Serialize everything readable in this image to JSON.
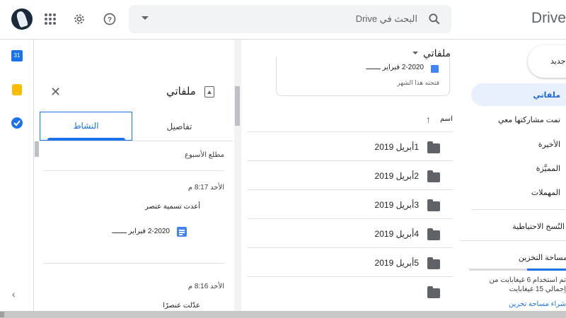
{
  "topbar": {
    "search_placeholder": "البحث في Drive",
    "brand": "Drive"
  },
  "icons": {
    "apps": "apps-grid-icon",
    "settings": "gear-icon",
    "help": "help-icon",
    "search": "search-icon"
  },
  "left_rail": {
    "calendar_label": "31"
  },
  "toolbar": {
    "location_label": "ملفاتي"
  },
  "details_panel": {
    "title": "ملفاتي",
    "tabs": [
      {
        "label": "تفاصيل",
        "active": false
      },
      {
        "label": "النشاط",
        "active": true
      }
    ],
    "section_label": "مطلع الأسبوع",
    "activities": [
      {
        "time": "الأحد 8:17 م",
        "action": "أعدت تسمية عنصر",
        "file": "2-2020 فبراير ـــــــ"
      },
      {
        "time": "الأحد 8:16 م",
        "action": "عدّلت عنصرًا"
      }
    ]
  },
  "main": {
    "suggested_card": {
      "title": "2-2020 فبراير ـــــــ",
      "subtitle": "فتحته هذا الشهر"
    },
    "column_header": "اسم",
    "folders": [
      "1أبريل 2019",
      "2أبريل 2019",
      "3أبريل 2019",
      "4أبريل 2019",
      "5أبريل 2019",
      ""
    ]
  },
  "nav": {
    "new_label": "جديد",
    "items": [
      {
        "label": "ملفاتي",
        "active": true
      },
      {
        "label": "تمت مشاركتها معي",
        "active": false
      },
      {
        "label": "الأخيرة",
        "active": false
      },
      {
        "label": "المميَّزة",
        "active": false
      },
      {
        "label": "المهملات",
        "active": false
      },
      {
        "label": "النُسخ الاحتياطية",
        "active": false
      },
      {
        "label": "مساحة التخزين",
        "active": false
      }
    ],
    "storage_text": "تم استخدام 6 غيغابايت من إجمالي 15 غيغابايت",
    "storage_used_fraction": 0.4,
    "buy_storage": "شراء مساحة تخزين"
  },
  "colors": {
    "accent": "#1a73e8",
    "active_bg": "#e8f0fe"
  }
}
